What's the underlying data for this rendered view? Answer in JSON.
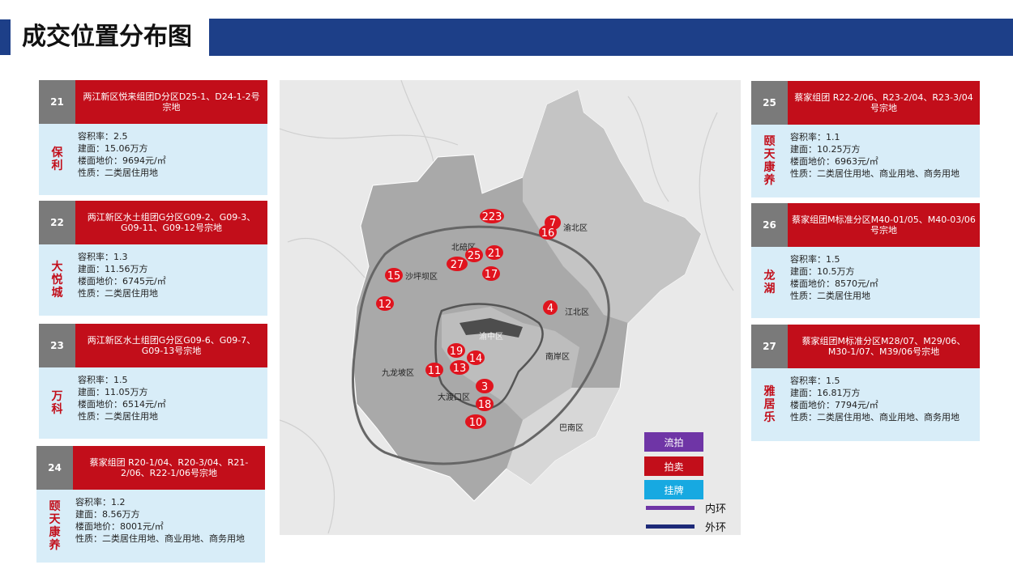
{
  "page": {
    "title": "成交位置分布图"
  },
  "cards": [
    {
      "num": "21",
      "land": "两江新区悦来组团D分区D25-1、D24-1-2号宗地",
      "developer": "保利",
      "far": "容积率：2.5",
      "area": "建面：15.06万方",
      "price": "楼面地价：9694元/㎡",
      "use": "性质：二类居住用地"
    },
    {
      "num": "22",
      "land": "两江新区水土组团G分区G09-2、G09-3、G09-11、G09-12号宗地",
      "developer": "大悦城",
      "far": "容积率：1.3",
      "area": "建面：11.56万方",
      "price": "楼面地价：6745元/㎡",
      "use": "性质：二类居住用地"
    },
    {
      "num": "23",
      "land": "两江新区水土组团G分区G09-6、G09-7、G09-13号宗地",
      "developer": "万科",
      "far": "容积率：1.5",
      "area": "建面：11.05万方",
      "price": "楼面地价：6514元/㎡",
      "use": "性质：二类居住用地"
    },
    {
      "num": "24",
      "land": "蔡家组团 R20-1/04、R20-3/04、R21-2/06、R22-1/06号宗地",
      "developer": "颐天康养",
      "far": "容积率：1.2",
      "area": "建面：8.56万方",
      "price": "楼面地价：8001元/㎡",
      "use": "性质：二类居住用地、商业用地、商务用地"
    },
    {
      "num": "25",
      "land": "蔡家组团 R22-2/06、R23-2/04、R23-3/04号宗地",
      "developer": "颐天康养",
      "far": "容积率：1.1",
      "area": "建面：10.25万方",
      "price": "楼面地价：6963元/㎡",
      "use": "性质：二类居住用地、商业用地、商务用地"
    },
    {
      "num": "26",
      "land": "蔡家组团M标准分区M40-01/05、M40-03/06号宗地",
      "developer": "龙湖",
      "far": "容积率：1.5",
      "area": "建面：10.5万方",
      "price": "楼面地价：8570元/㎡",
      "use": "性质：二类居住用地"
    },
    {
      "num": "27",
      "land": "蔡家组团M标准分区M28/07、M29/06、M30-1/07、M39/06号宗地",
      "developer": "雅居乐",
      "far": "容积率：1.5",
      "area": "建面：16.81万方",
      "price": "楼面地价：7794元/㎡",
      "use": "性质：二类居住用地、商业用地、商务用地"
    }
  ],
  "map": {
    "districts": [
      "北碚区",
      "渝北区",
      "沙坪坝区",
      "江北区",
      "渝中区",
      "九龙坡区",
      "南岸区",
      "大渡口区",
      "巴南区"
    ],
    "pins": [
      "223",
      "7",
      "16",
      "25",
      "21",
      "27",
      "17",
      "15",
      "12",
      "4",
      "19",
      "14",
      "11",
      "13",
      "3",
      "18",
      "10"
    ]
  },
  "legend": {
    "items": [
      {
        "label": "流拍",
        "color": "#6f35a6"
      },
      {
        "label": "拍卖",
        "color": "#c20e1a"
      },
      {
        "label": "挂牌",
        "color": "#17a9e1"
      }
    ],
    "inner_ring": "内环",
    "inner_color": "#6f35a6",
    "outer_ring": "外环",
    "outer_color": "#1d2a78"
  }
}
